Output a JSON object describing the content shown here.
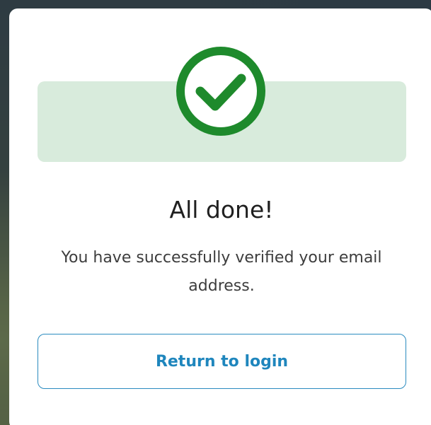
{
  "dialog": {
    "icon": "check-circle-icon",
    "title": "All done!",
    "message": "You have successfully verified your email address.",
    "button_label": "Return to login"
  },
  "colors": {
    "success": "#1e8a2c",
    "banner": "#d8ebdc",
    "accent": "#1f86bd"
  }
}
